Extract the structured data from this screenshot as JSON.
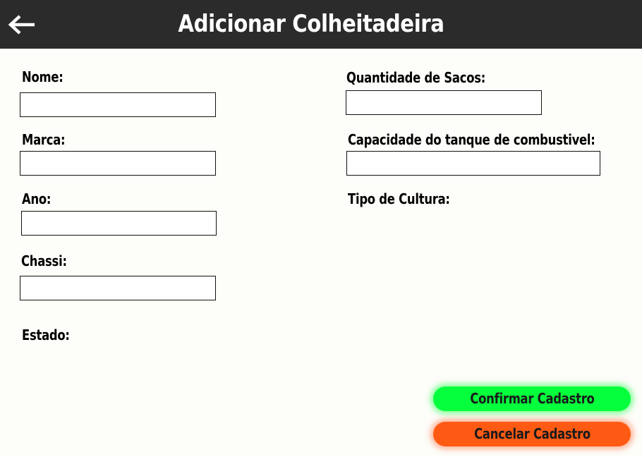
{
  "header": {
    "title": "Adicionar Colheitadeira",
    "back_icon": "arrow-left-icon"
  },
  "form": {
    "left": {
      "nome_label": "Nome:",
      "nome_value": "",
      "marca_label": "Marca:",
      "marca_value": "",
      "ano_label": "Ano:",
      "ano_value": "",
      "chassi_label": "Chassi:",
      "chassi_value": "",
      "estado_label": "Estado:"
    },
    "right": {
      "sacos_label": "Quantidade de Sacos:",
      "sacos_value": "",
      "tanque_label": "Capacidade do tanque de combustivel:",
      "tanque_value": "",
      "cultura_label": "Tipo de Cultura:"
    }
  },
  "actions": {
    "confirm_label": "Confirmar Cadastro",
    "cancel_label": "Cancelar Cadastro"
  },
  "colors": {
    "header_bg": "#2b2b2b",
    "confirm": "#05ff3c",
    "cancel": "#ff5a13"
  }
}
